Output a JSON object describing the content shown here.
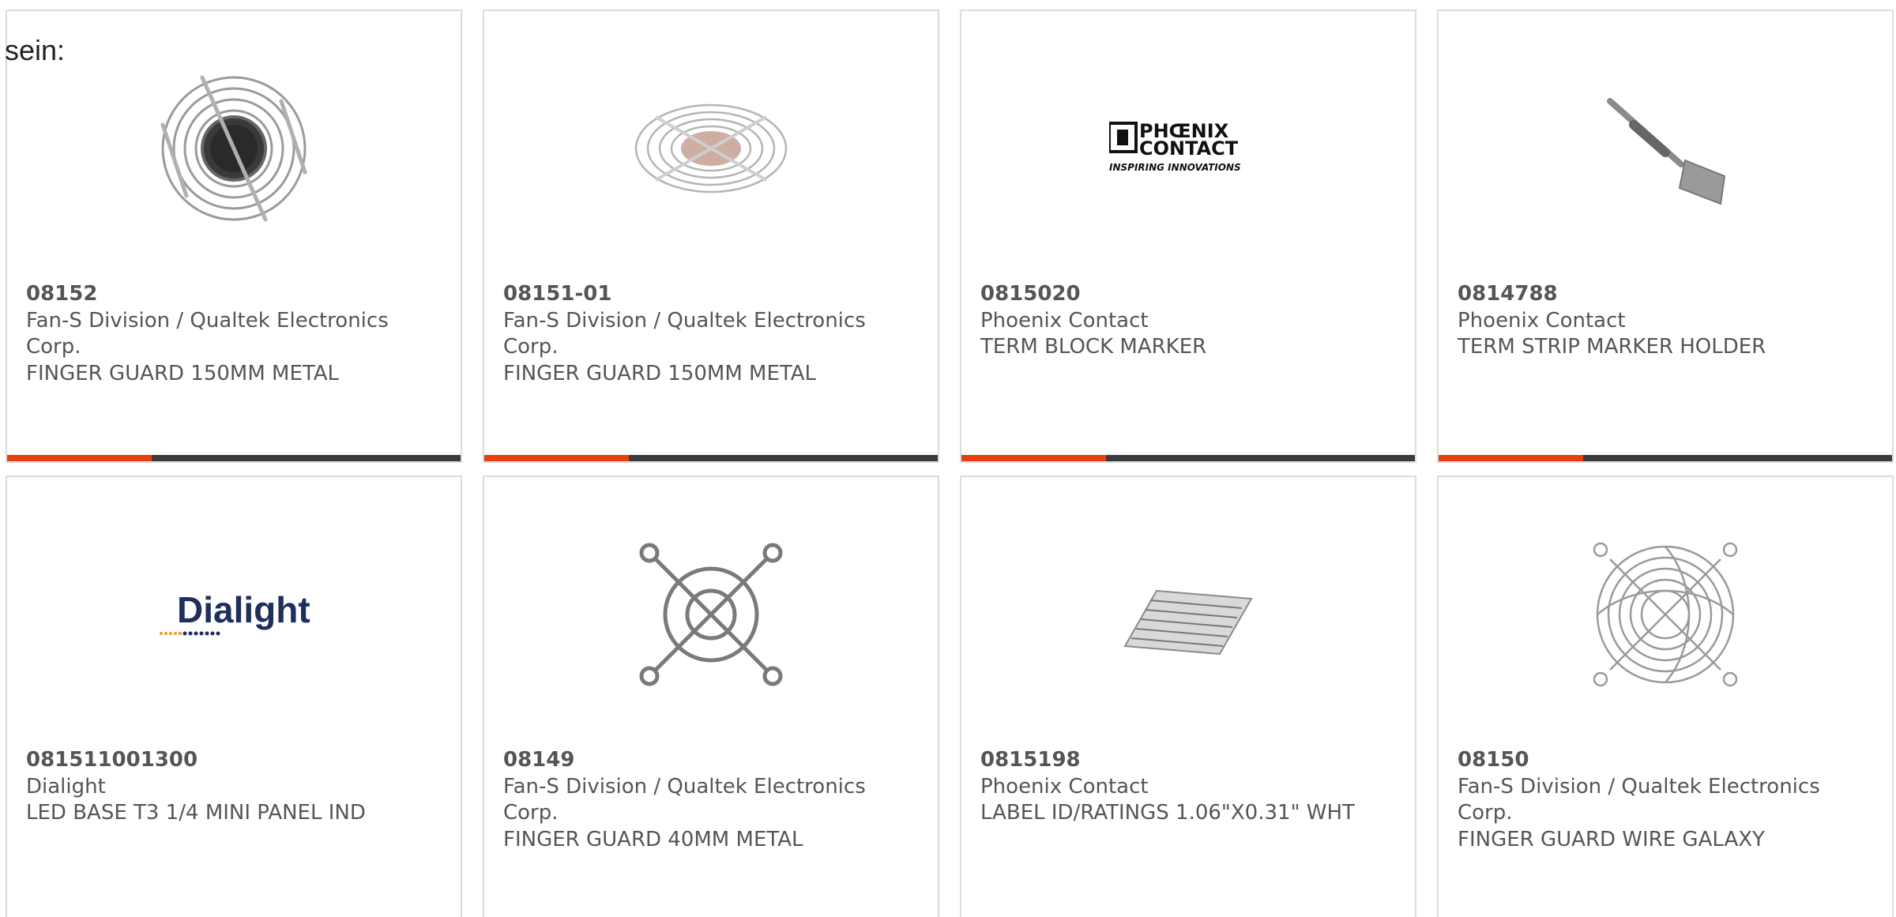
{
  "intro_text": "sein:",
  "brand_colors": {
    "accent": "#e8400c",
    "bar_dark": "#3b3b3b",
    "border": "#dcdcdc",
    "text": "#555555"
  },
  "products": [
    {
      "part_number": "08152",
      "manufacturer": "Fan-S Division / Qualtek Electronics Corp.",
      "description": "FINGER GUARD 150MM METAL",
      "image": "fan-guard-round-image",
      "accent_bar": true
    },
    {
      "part_number": "08151-01",
      "manufacturer": "Fan-S Division / Qualtek Electronics Corp.",
      "description": "FINGER GUARD 150MM METAL",
      "image": "fan-guard-oval-image",
      "accent_bar": true
    },
    {
      "part_number": "0815020",
      "manufacturer": "Phoenix Contact",
      "description": "TERM BLOCK MARKER",
      "image": "phoenix-contact-logo",
      "logo_lines": [
        "PHŒNIX",
        "CONTACT",
        "INSPIRING INNOVATIONS"
      ],
      "accent_bar": true
    },
    {
      "part_number": "0814788",
      "manufacturer": "Phoenix Contact",
      "description": "TERM STRIP MARKER HOLDER",
      "image": "marker-holder-image",
      "accent_bar": true
    },
    {
      "part_number": "081511001300",
      "manufacturer": "Dialight",
      "description": "LED BASE T3 1/4 MINI PANEL IND",
      "image": "dialight-logo",
      "logo_lines": [
        "Dialight"
      ],
      "accent_bar": false
    },
    {
      "part_number": "08149",
      "manufacturer": "Fan-S Division / Qualtek Electronics Corp.",
      "description": "FINGER GUARD 40MM METAL",
      "image": "fan-guard-small-image",
      "accent_bar": false
    },
    {
      "part_number": "0815198",
      "manufacturer": "Phoenix Contact",
      "description": "LABEL ID/RATINGS 1.06\"X0.31\" WHT",
      "image": "label-sheet-image",
      "accent_bar": false
    },
    {
      "part_number": "08150",
      "manufacturer": "Fan-S Division / Qualtek Electronics Corp.",
      "description": "FINGER GUARD WIRE GALAXY",
      "image": "fan-guard-galaxy-image",
      "accent_bar": false
    }
  ]
}
